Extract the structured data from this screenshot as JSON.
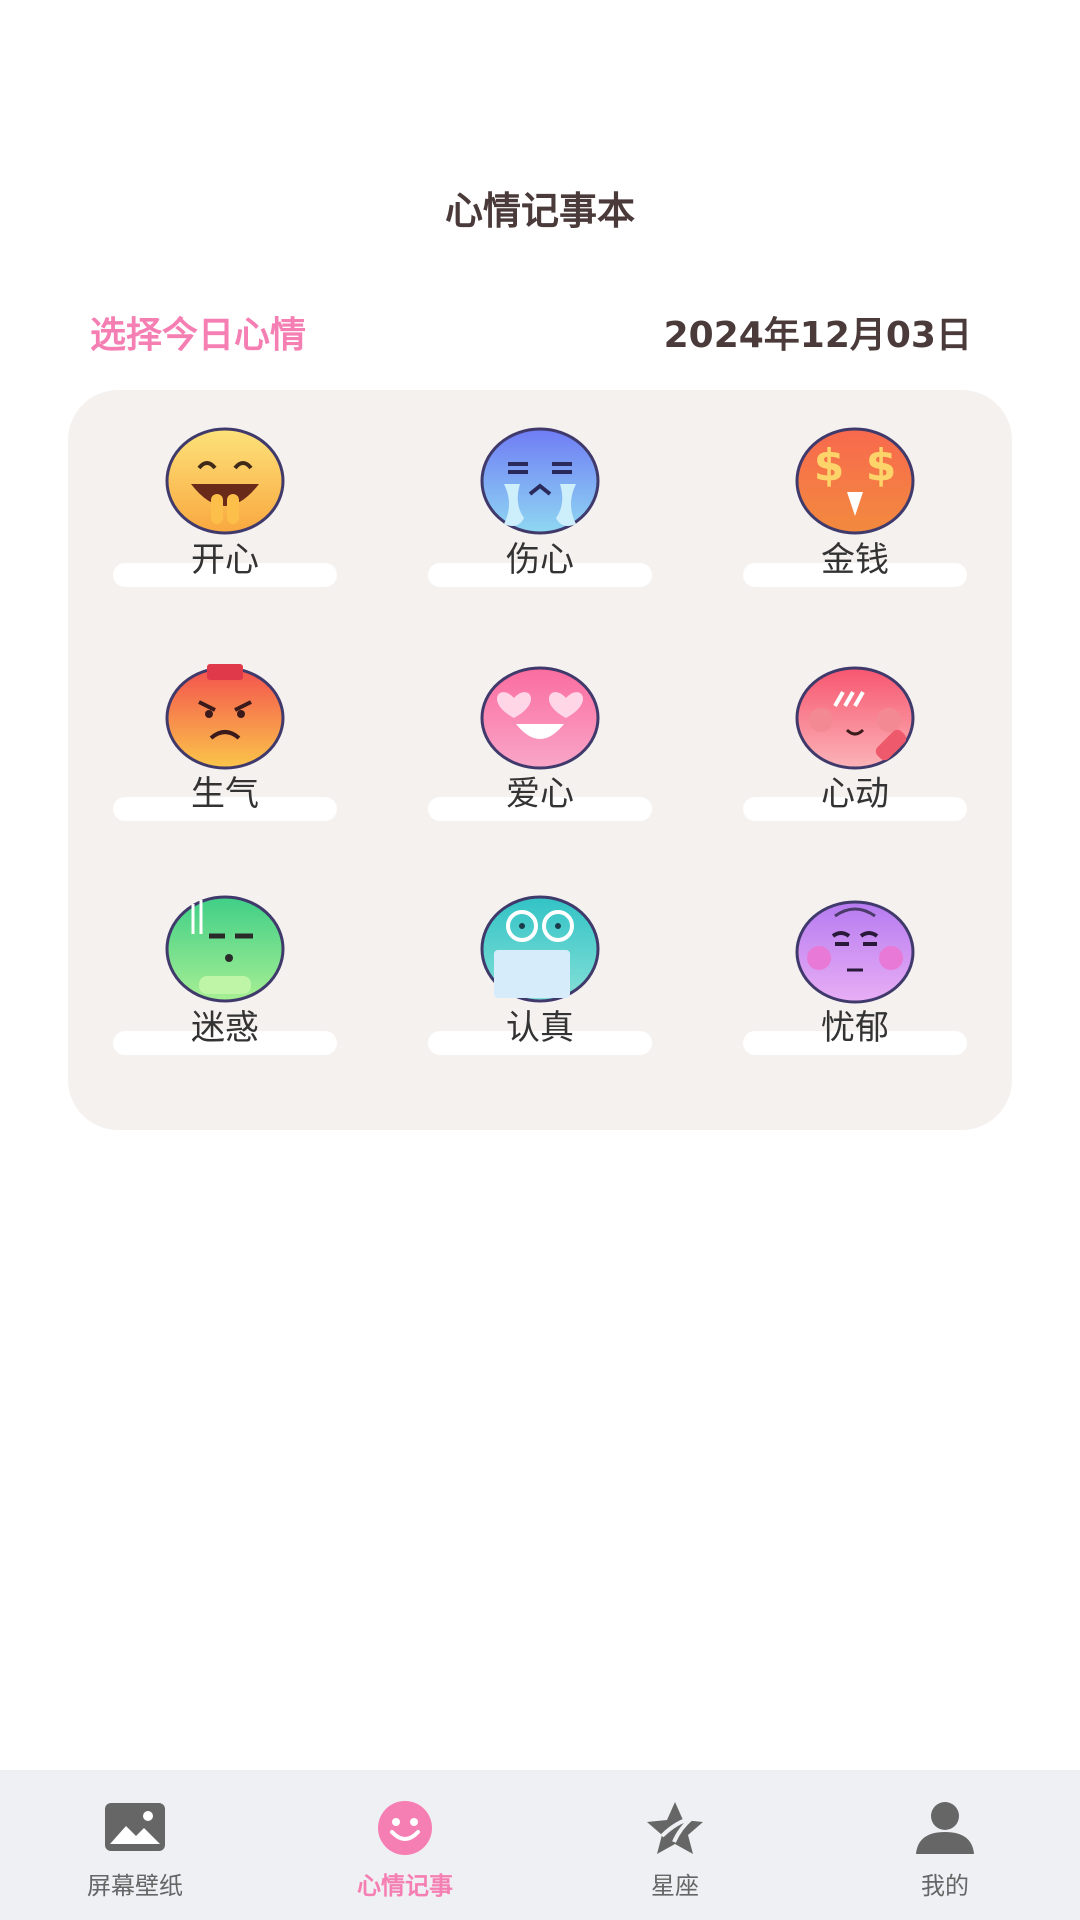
{
  "header": {
    "title": "心情记事本"
  },
  "mood_section": {
    "prompt": "选择今日心情",
    "date": "2024年12月03日"
  },
  "moods": [
    {
      "label": "开心",
      "icon": "happy-face-icon"
    },
    {
      "label": "伤心",
      "icon": "crying-face-icon"
    },
    {
      "label": "金钱",
      "icon": "money-eyes-face-icon"
    },
    {
      "label": "生气",
      "icon": "angry-face-icon"
    },
    {
      "label": "爱心",
      "icon": "heart-eyes-face-icon"
    },
    {
      "label": "心动",
      "icon": "blushing-face-icon"
    },
    {
      "label": "迷惑",
      "icon": "confused-face-icon"
    },
    {
      "label": "认真",
      "icon": "serious-face-icon"
    },
    {
      "label": "忧郁",
      "icon": "melancholy-face-icon"
    }
  ],
  "tab_bar": {
    "active_color": "#f57fb3",
    "inactive_color": "#666666",
    "tabs": [
      {
        "label": "屏幕壁纸",
        "icon": "wallpaper-icon",
        "active": false
      },
      {
        "label": "心情记事",
        "icon": "smiley-icon",
        "active": true
      },
      {
        "label": "星座",
        "icon": "star-icon",
        "active": false
      },
      {
        "label": "我的",
        "icon": "user-icon",
        "active": false
      }
    ]
  }
}
